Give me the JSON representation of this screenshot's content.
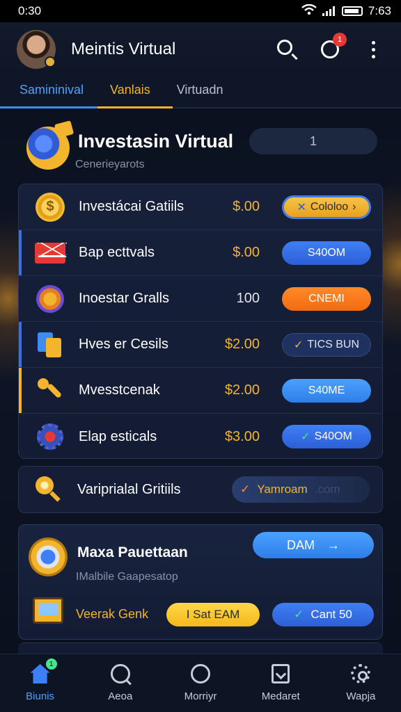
{
  "status_bar": {
    "time": "0:30",
    "clock_right": "7:63"
  },
  "header": {
    "title": "Meintis Virtual",
    "notification_count": "1"
  },
  "tabs": [
    {
      "label": "Samininival"
    },
    {
      "label": "Vanlais"
    },
    {
      "label": "Virtuadn"
    }
  ],
  "section": {
    "title": "Investasin Virtual",
    "subtitle": "Cenerieyarots",
    "page_indicator": "1"
  },
  "rows": [
    {
      "label": "Investácai Gatiils",
      "amount": "$.00",
      "button": "Cololoo",
      "button_icon": "x-icon",
      "style": "gold",
      "accent": ""
    },
    {
      "label": "Bap ecttvals",
      "amount": "$.00",
      "button": "S40OM",
      "button_icon": "",
      "style": "blue",
      "accent": "#3d6fd8"
    },
    {
      "label": "Inoestar Gralls",
      "amount": "100",
      "button": "CNEMI",
      "button_icon": "",
      "style": "orange",
      "accent": ""
    },
    {
      "label": "Hves er Cesils",
      "amount": "$2.00",
      "button": "TICS BUN",
      "button_icon": "check-icon",
      "style": "navy",
      "accent": "#3d6fd8"
    },
    {
      "label": "Mvesstcenak",
      "amount": "$2.00",
      "button": "S40ME",
      "button_icon": "",
      "style": "sky",
      "accent": "#f3b52e"
    },
    {
      "label": "Elap esticals",
      "amount": "$3.00",
      "button": "S40OM",
      "button_icon": "check-icon",
      "style": "blue",
      "accent": ""
    }
  ],
  "promo": {
    "label": "Variprialal Gritiils",
    "pill_text": "Yamroam",
    "pill_ghost": ".com"
  },
  "bottom_card": {
    "title": "Maxa Pauettaan",
    "subtitle": "IMalbile Gaapesatop",
    "cta": "DAM",
    "row_label": "Veerak Genk",
    "btn_primary": "I Sat EAM",
    "btn_secondary": "Cant 50"
  },
  "bottom_nav": [
    {
      "label": "Biunis",
      "icon": "home-icon",
      "badge": "1"
    },
    {
      "label": "Aeoa",
      "icon": "search-icon"
    },
    {
      "label": "Morriyr",
      "icon": "circle-icon"
    },
    {
      "label": "Medaret",
      "icon": "document-icon"
    },
    {
      "label": "Wapja",
      "icon": "gear-icon"
    }
  ],
  "colors": {
    "accent_blue": "#3f7ff5",
    "accent_gold": "#f3b52e",
    "accent_orange": "#f26a0e",
    "background": "#0b1120"
  }
}
